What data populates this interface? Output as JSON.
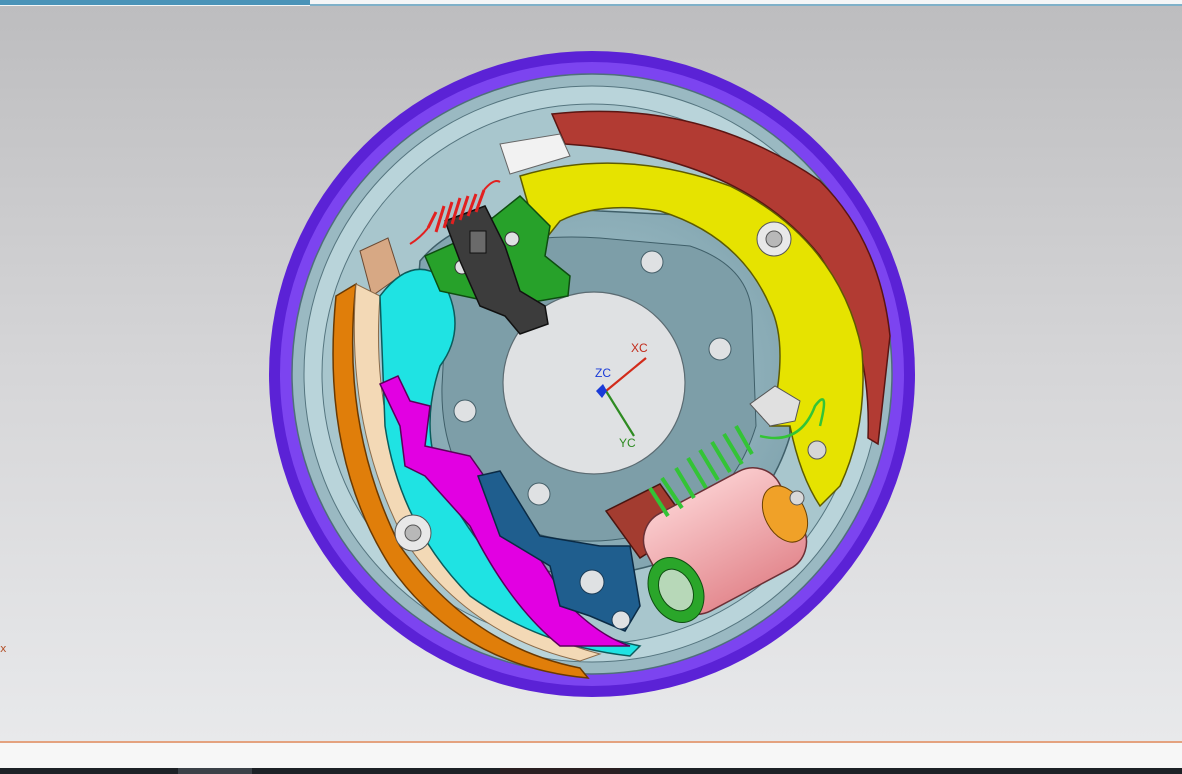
{
  "graphics_window": {
    "triad_labels": {
      "x": "XC",
      "y": "YC",
      "z": "ZC"
    },
    "edge_marker": "x",
    "part_colors": {
      "drum_rim": "#6a2ee6",
      "leading_lining": "#b23b33",
      "leading_shoe": "#e4e000",
      "trailing_shoe_web": "#1fe0e0",
      "trailing_lining": "#e07e0a",
      "adjuster_lever": "#e200e2",
      "strut": "#1f5e8e",
      "backing_plate": "#6f95a0",
      "return_spring": "#37c43a",
      "top_spring": "#e02222",
      "wheel_cylinder": "#f4a9ad",
      "park_bracket": "#2aa62a"
    }
  }
}
